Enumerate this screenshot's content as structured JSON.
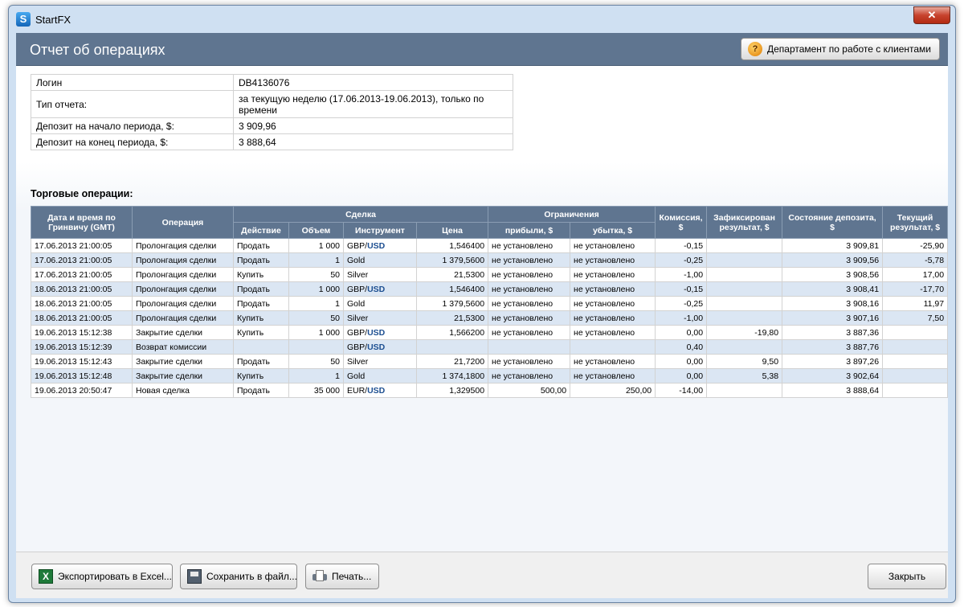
{
  "window": {
    "app_title": "StartFX",
    "close_glyph": "✕",
    "app_icon_letter": "S"
  },
  "header": {
    "title": "Отчет об операциях",
    "support_button": "Департамент по работе с клиентами"
  },
  "info": {
    "rows": [
      {
        "label": "Логин",
        "value": "DB4136076"
      },
      {
        "label": "Тип отчета:",
        "value": "за текущую неделю (17.06.2013-19.06.2013), только по времени"
      },
      {
        "label": "Депозит на начало периода, $:",
        "value": "3 909,96"
      },
      {
        "label": "Депозит на конец периода, $:",
        "value": "3 888,64"
      }
    ]
  },
  "operations": {
    "section_title": "Торговые операции:",
    "headers": {
      "datetime": "Дата и время по Гринвичу (GMT)",
      "operation": "Операция",
      "deal": "Сделка",
      "action": "Действие",
      "volume": "Объем",
      "instrument": "Инструмент",
      "price": "Цена",
      "limits": "Ограничения",
      "profit": "прибыли, $",
      "loss": "убытка, $",
      "commission": "Комиссия, $",
      "fixed_result": "Зафиксирован результат, $",
      "deposit_state": "Состояние депозита, $",
      "current_result": "Текущий результат, $"
    },
    "rows": [
      {
        "datetime": "17.06.2013 21:00:05",
        "operation": "Пролонгация сделки",
        "action": "Продать",
        "volume": "1 000",
        "instr_base": "GBP/",
        "instr_quote": "USD",
        "price": "1,546400",
        "profit": "не установлено",
        "loss": "не установлено",
        "commission": "-0,15",
        "fixed": "",
        "deposit": "3 909,81",
        "current": "-25,90"
      },
      {
        "datetime": "17.06.2013 21:00:05",
        "operation": "Пролонгация сделки",
        "action": "Продать",
        "volume": "1",
        "instr_base": "Gold",
        "instr_quote": "",
        "price": "1 379,5600",
        "profit": "не установлено",
        "loss": "не установлено",
        "commission": "-0,25",
        "fixed": "",
        "deposit": "3 909,56",
        "current": "-5,78"
      },
      {
        "datetime": "17.06.2013 21:00:05",
        "operation": "Пролонгация сделки",
        "action": "Купить",
        "volume": "50",
        "instr_base": "Silver",
        "instr_quote": "",
        "price": "21,5300",
        "profit": "не установлено",
        "loss": "не установлено",
        "commission": "-1,00",
        "fixed": "",
        "deposit": "3 908,56",
        "current": "17,00"
      },
      {
        "datetime": "18.06.2013 21:00:05",
        "operation": "Пролонгация сделки",
        "action": "Продать",
        "volume": "1 000",
        "instr_base": "GBP/",
        "instr_quote": "USD",
        "price": "1,546400",
        "profit": "не установлено",
        "loss": "не установлено",
        "commission": "-0,15",
        "fixed": "",
        "deposit": "3 908,41",
        "current": "-17,70"
      },
      {
        "datetime": "18.06.2013 21:00:05",
        "operation": "Пролонгация сделки",
        "action": "Продать",
        "volume": "1",
        "instr_base": "Gold",
        "instr_quote": "",
        "price": "1 379,5600",
        "profit": "не установлено",
        "loss": "не установлено",
        "commission": "-0,25",
        "fixed": "",
        "deposit": "3 908,16",
        "current": "11,97"
      },
      {
        "datetime": "18.06.2013 21:00:05",
        "operation": "Пролонгация сделки",
        "action": "Купить",
        "volume": "50",
        "instr_base": "Silver",
        "instr_quote": "",
        "price": "21,5300",
        "profit": "не установлено",
        "loss": "не установлено",
        "commission": "-1,00",
        "fixed": "",
        "deposit": "3 907,16",
        "current": "7,50"
      },
      {
        "datetime": "19.06.2013 15:12:38",
        "operation": "Закрытие сделки",
        "action": "Купить",
        "volume": "1 000",
        "instr_base": "GBP/",
        "instr_quote": "USD",
        "price": "1,566200",
        "profit": "не установлено",
        "loss": "не установлено",
        "commission": "0,00",
        "fixed": "-19,80",
        "deposit": "3 887,36",
        "current": ""
      },
      {
        "datetime": "19.06.2013 15:12:39",
        "operation": "Возврат комиссии",
        "action": "",
        "volume": "",
        "instr_base": "GBP/",
        "instr_quote": "USD",
        "price": "",
        "profit": "",
        "loss": "",
        "commission": "0,40",
        "fixed": "",
        "deposit": "3 887,76",
        "current": ""
      },
      {
        "datetime": "19.06.2013 15:12:43",
        "operation": "Закрытие сделки",
        "action": "Продать",
        "volume": "50",
        "instr_base": "Silver",
        "instr_quote": "",
        "price": "21,7200",
        "profit": "не установлено",
        "loss": "не установлено",
        "commission": "0,00",
        "fixed": "9,50",
        "deposit": "3 897,26",
        "current": ""
      },
      {
        "datetime": "19.06.2013 15:12:48",
        "operation": "Закрытие сделки",
        "action": "Купить",
        "volume": "1",
        "instr_base": "Gold",
        "instr_quote": "",
        "price": "1 374,1800",
        "profit": "не установлено",
        "loss": "не установлено",
        "commission": "0,00",
        "fixed": "5,38",
        "deposit": "3 902,64",
        "current": ""
      },
      {
        "datetime": "19.06.2013 20:50:47",
        "operation": "Новая сделка",
        "action": "Продать",
        "volume": "35 000",
        "instr_base": "EUR/",
        "instr_quote": "USD",
        "price": "1,329500",
        "profit": "500,00",
        "loss": "250,00",
        "commission": "-14,00",
        "fixed": "",
        "deposit": "3 888,64",
        "current": ""
      }
    ]
  },
  "footer": {
    "export_excel": "Экспортировать в Excel...",
    "save_file": "Сохранить в файл...",
    "print": "Печать...",
    "close": "Закрыть"
  },
  "icons": {
    "app": "app-logo-icon",
    "support": "headset-icon",
    "excel": "excel-icon",
    "save": "floppy-disk-icon",
    "print": "printer-icon"
  },
  "colors": {
    "header": "#5f7590",
    "row_alt": "#dbe6f3",
    "usd": "#1d4f91"
  }
}
